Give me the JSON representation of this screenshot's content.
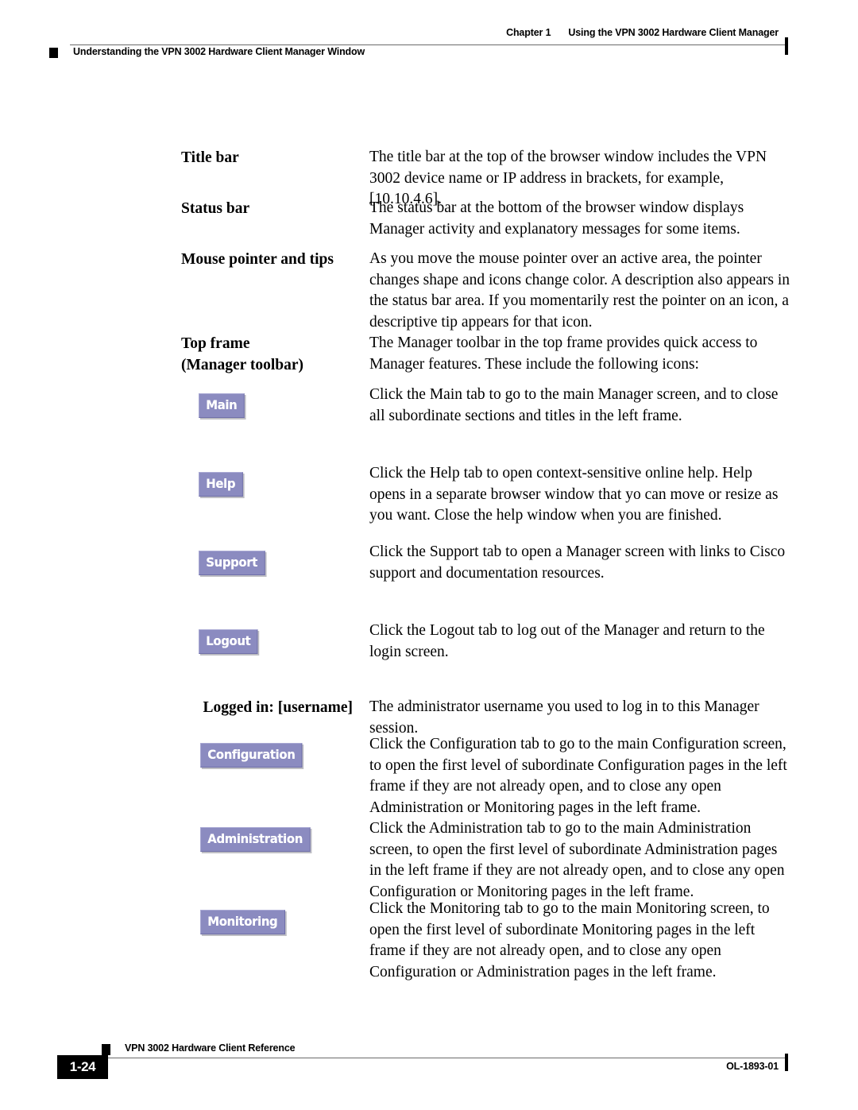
{
  "header": {
    "chapter_number": "Chapter 1",
    "chapter_title": "Using the VPN 3002 Hardware Client Manager",
    "running_head": "Understanding the VPN 3002 Hardware Client Manager Window"
  },
  "footer": {
    "page_number": "1-24",
    "book_title": "VPN 3002 Hardware Client Reference",
    "doc_id": "OL-1893-01"
  },
  "colors": {
    "tab_background": "#8b8bc0",
    "tab_text": "#ffffff",
    "rule": "#6b6b6b",
    "ink": "#000000"
  },
  "definitions": [
    {
      "label": "Title bar",
      "description": "The title bar at the top of the browser window includes the VPN 3002 device name or IP address in brackets, for example, [10.10.4.6]."
    },
    {
      "label": "Status bar",
      "description": "The status bar at the bottom of the browser window displays Manager activity and explanatory messages for some items."
    },
    {
      "label": "Mouse pointer and tips",
      "description": "As you move the mouse pointer over an active area, the pointer changes shape and icons change color. A description also appears in the status bar area. If you momentarily rest the pointer on an icon, a descriptive tip appears for that icon."
    },
    {
      "label_line1": "Top frame",
      "label_line2": "(Manager toolbar)",
      "description": "The Manager toolbar in the top frame provides quick access to Manager features. These include the following icons:"
    },
    {
      "icon_label": "Main",
      "description": "Click the Main tab to go to the main Manager screen, and to close all subordinate sections and titles in the left frame."
    },
    {
      "icon_label": "Help",
      "description": "Click the Help tab to open context-sensitive online help. Help opens in a separate browser window that yo can move or resize as you want. Close the help window when you are finished."
    },
    {
      "icon_label": "Support",
      "description": "Click the Support tab to open a Manager screen with links to Cisco support and documentation resources."
    },
    {
      "icon_label": "Logout",
      "description": "Click the Logout tab to log out of the Manager and return to the login screen."
    },
    {
      "label": "Logged in: [username]",
      "description": "The administrator username you used to log in to this Manager session."
    },
    {
      "icon_label": "Configuration",
      "description": "Click the Configuration tab to go to the main Configuration screen, to open the first level of subordinate Configuration pages in the left frame if they are not already open, and to close any open Administration or Monitoring pages in the left frame."
    },
    {
      "icon_label": "Administration",
      "description": "Click the Administration tab to go to the main Administration screen, to open the first level of subordinate Administration pages in the left frame if they are not already open, and to close any open Configuration or Monitoring pages in the left frame."
    },
    {
      "icon_label": "Monitoring",
      "description": "Click the Monitoring tab to go to the main Monitoring screen, to open the first level of subordinate Monitoring pages in the left frame if they are not already open, and to close any open Configuration or Administration pages in the left frame."
    }
  ]
}
